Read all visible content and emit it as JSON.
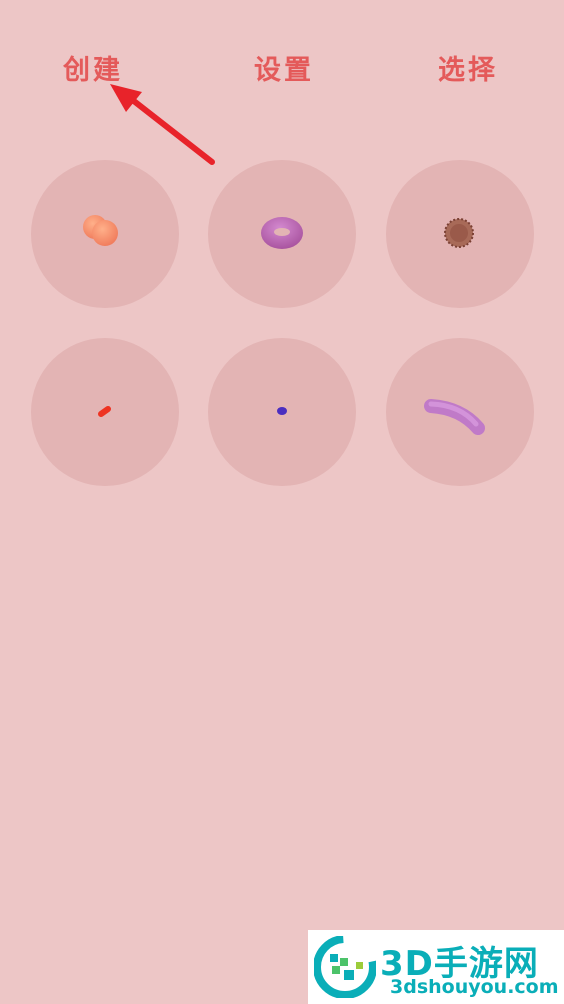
{
  "nav": {
    "create_label": "创建",
    "settings_label": "设置",
    "select_label": "选择"
  },
  "colors": {
    "background": "#edc6c6",
    "cell": "#e3b4b4",
    "nav_text": "#e45a5a",
    "annotation_arrow": "#e8232a",
    "watermark_text": "#0aaeb8"
  },
  "grid": {
    "items": [
      {
        "icon": "peach-blob-icon"
      },
      {
        "icon": "purple-torus-icon"
      },
      {
        "icon": "brown-spiky-ball-icon"
      },
      {
        "icon": "red-capsule-icon"
      },
      {
        "icon": "blue-dot-icon"
      },
      {
        "icon": "pink-worm-icon"
      }
    ]
  },
  "watermark": {
    "name": "3D手游网",
    "url": "3dshouyou.com"
  }
}
